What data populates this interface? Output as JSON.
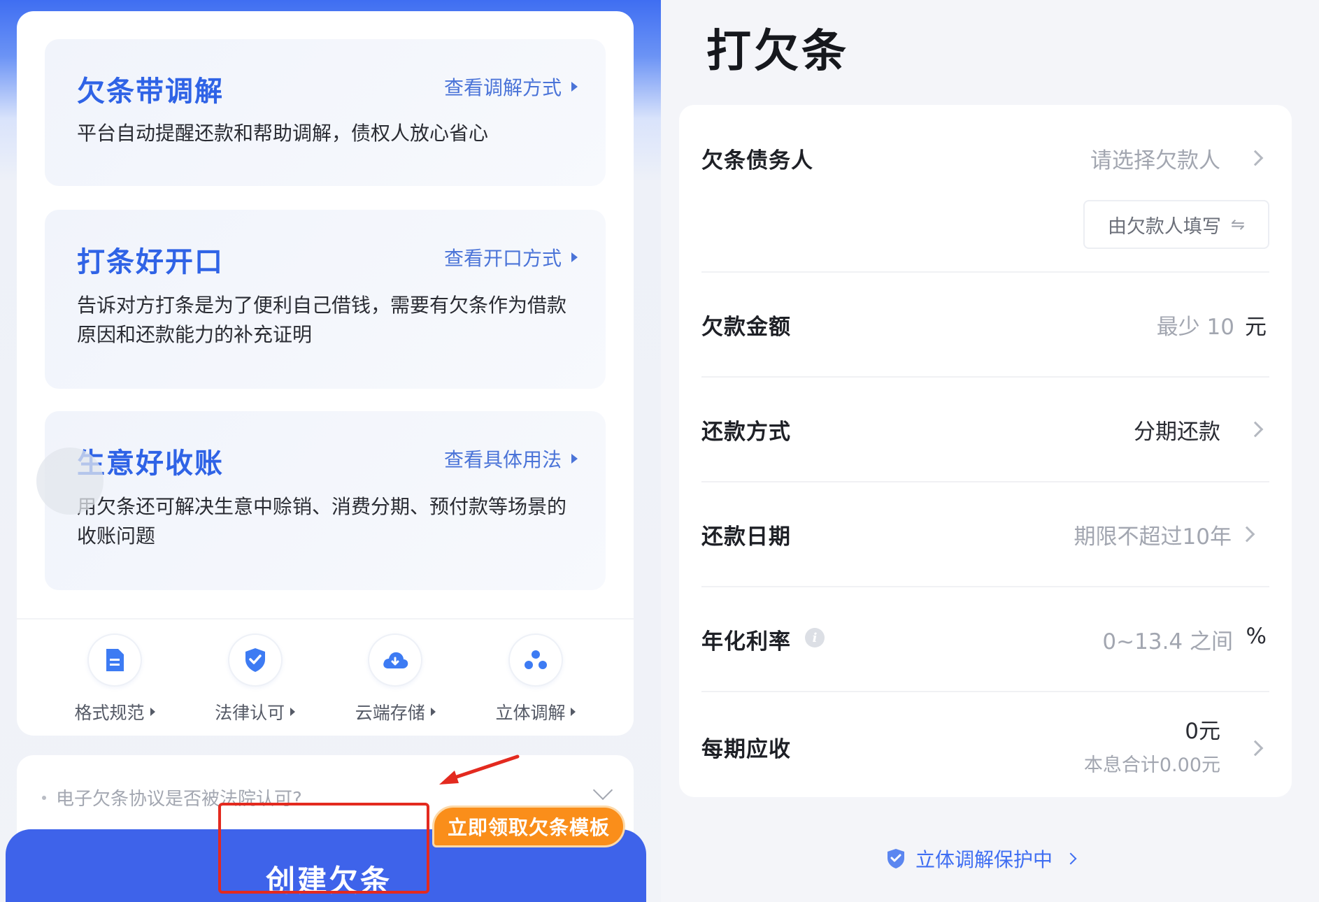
{
  "left": {
    "features": [
      {
        "title": "欠条带调解",
        "link": "查看调解方式",
        "desc": "平台自动提醒还款和帮助调解，债权人放心省心"
      },
      {
        "title": "打条好开口",
        "link": "查看开口方式",
        "desc": "告诉对方打条是为了便利自己借钱，需要有欠条作为借款原因和还款能力的补充证明"
      },
      {
        "title": "生意好收账",
        "link": "查看具体用法",
        "desc": "用欠条还可解决生意中赊销、消费分期、预付款等场景的收账问题"
      }
    ],
    "icons": [
      {
        "label": "格式规范",
        "icon": "document-icon"
      },
      {
        "label": "法律认可",
        "icon": "shield-check-icon"
      },
      {
        "label": "云端存储",
        "icon": "cloud-download-icon"
      },
      {
        "label": "立体调解",
        "icon": "people-icon"
      }
    ],
    "faq": {
      "question": "电子欠条协议是否被法院认可?"
    },
    "create_button": "创建欠条",
    "template_tag": "立即领取欠条模板",
    "colors": {
      "primary": "#3e63ea",
      "accent_orange": "#fa8e1a",
      "highlight_red": "#e32a1f"
    }
  },
  "right": {
    "title": "打欠条",
    "form": {
      "debtor": {
        "label": "欠条债务人",
        "placeholder": "请选择欠款人",
        "sub_button": "由欠款人填写"
      },
      "amount": {
        "label": "欠款金额",
        "placeholder": "最少 10",
        "unit": "元"
      },
      "repay_method": {
        "label": "还款方式",
        "value": "分期还款"
      },
      "repay_date": {
        "label": "还款日期",
        "placeholder": "期限不超过10年"
      },
      "rate": {
        "label": "年化利率",
        "placeholder": "0~13.4 之间",
        "unit": "%"
      },
      "per_period": {
        "label": "每期应收",
        "value": "0元",
        "sub": "本息合计0.00元"
      }
    },
    "protection": "立体调解保护中"
  }
}
